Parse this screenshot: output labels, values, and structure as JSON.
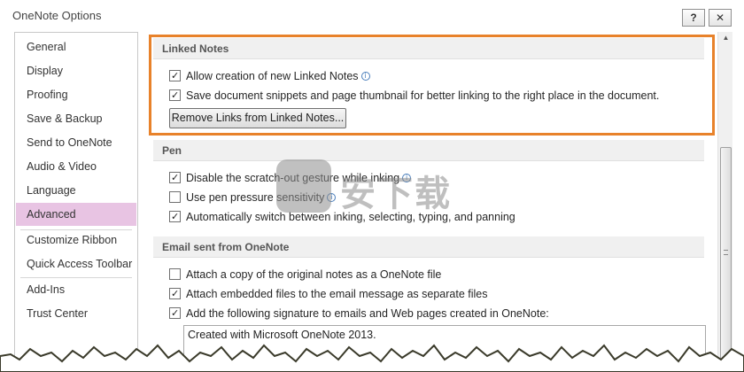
{
  "window": {
    "title": "OneNote Options",
    "help_glyph": "?",
    "close_glyph": "✕"
  },
  "sidebar": {
    "items": [
      {
        "label": "General"
      },
      {
        "label": "Display"
      },
      {
        "label": "Proofing"
      },
      {
        "label": "Save & Backup"
      },
      {
        "label": "Send to OneNote"
      },
      {
        "label": "Audio & Video"
      },
      {
        "label": "Language"
      },
      {
        "label": "Advanced",
        "selected": true
      },
      {
        "label": "Customize Ribbon"
      },
      {
        "label": "Quick Access Toolbar"
      },
      {
        "label": "Add-Ins"
      },
      {
        "label": "Trust Center"
      }
    ]
  },
  "sections": {
    "linked_notes": {
      "header": "Linked Notes",
      "options": [
        {
          "label": "Allow creation of new Linked Notes",
          "checked": true,
          "info": true
        },
        {
          "label": "Save document snippets and page thumbnail for better linking to the right place in the document.",
          "checked": true
        }
      ],
      "button": "Remove Links from Linked Notes..."
    },
    "pen": {
      "header": "Pen",
      "options": [
        {
          "label": "Disable the scratch-out gesture while inking",
          "checked": true,
          "info": true
        },
        {
          "label": "Use pen pressure sensitivity",
          "checked": false,
          "info": true
        },
        {
          "label": "Automatically switch between inking, selecting, typing, and panning",
          "checked": true
        }
      ]
    },
    "email": {
      "header": "Email sent from OneNote",
      "options": [
        {
          "label": "Attach a copy of the original notes as a OneNote file",
          "checked": false
        },
        {
          "label": "Attach embedded files to the email message as separate files",
          "checked": true
        },
        {
          "label": "Add the following signature to emails and Web pages created in OneNote:",
          "checked": true
        }
      ],
      "signature": "Created with Microsoft OneNote 2013."
    }
  },
  "colors": {
    "highlight": "#e8822a",
    "selected_nav": "#e8c4e3"
  },
  "icons": {
    "info": "info-icon"
  }
}
